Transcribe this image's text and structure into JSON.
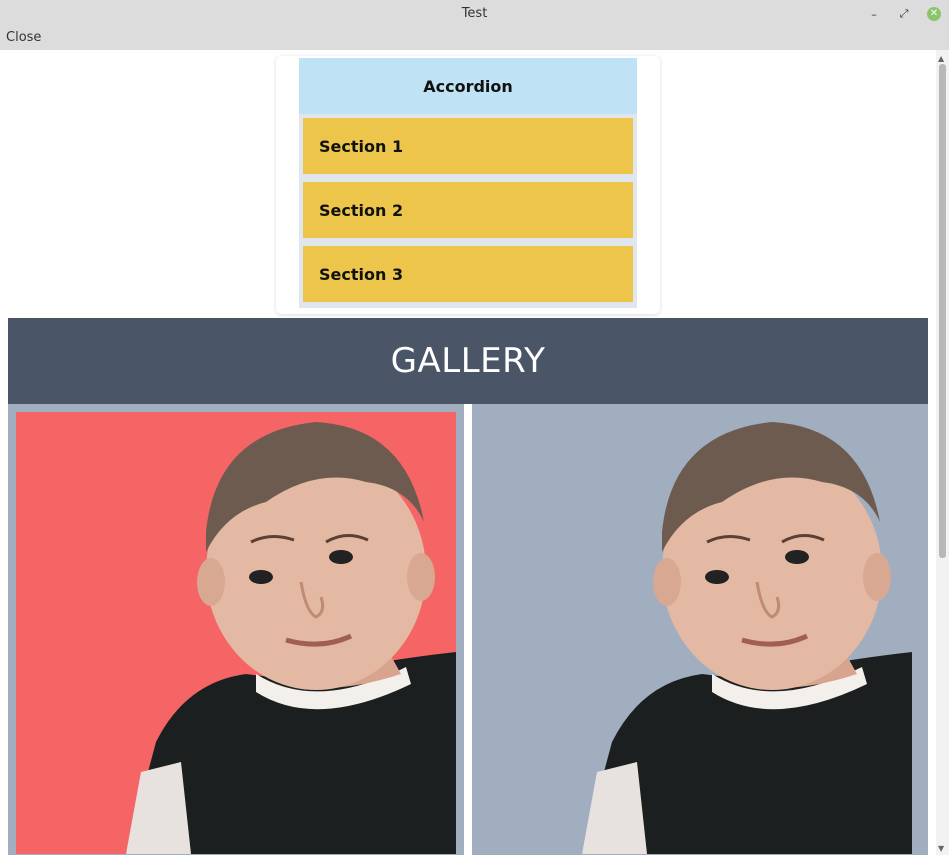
{
  "window": {
    "title": "Test",
    "minimize_glyph": "–",
    "maximize_glyph": "⤢",
    "close_glyph": "✕"
  },
  "menubar": {
    "close_label": "Close"
  },
  "accordion": {
    "header": "Accordion",
    "sections": [
      "Section 1",
      "Section 2",
      "Section 3"
    ]
  },
  "gallery": {
    "title": "GALLERY",
    "photos": [
      {
        "alt": "Child portrait on red background",
        "background": "#f56565"
      },
      {
        "alt": "Child portrait on gray-blue background",
        "background": "#a0aec0"
      }
    ]
  },
  "colors": {
    "accordion_header": "#bfe2f5",
    "section_bg": "#ecc54a",
    "gallery_header": "#4a5568",
    "gallery_bg": "#a0aec0",
    "photo_red": "#f56565"
  }
}
